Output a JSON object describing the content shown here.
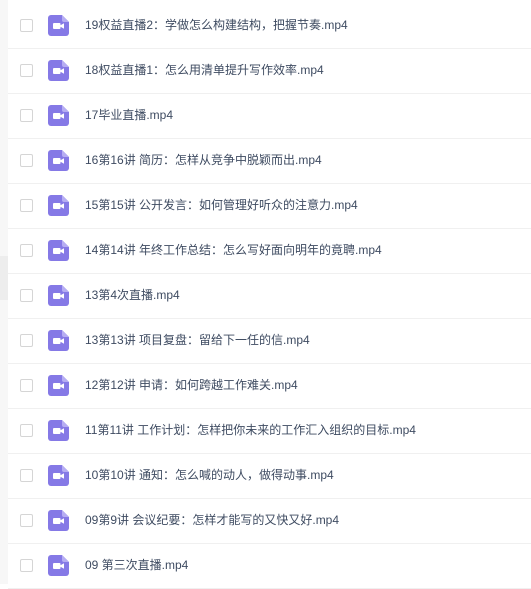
{
  "colors": {
    "video_icon": "#8579e6",
    "text": "#3e4b61",
    "divider": "#f0f0f0"
  },
  "file_icon": "video-file-icon",
  "files": [
    {
      "name": "19权益直播2：学做怎么构建结构，把握节奏.mp4"
    },
    {
      "name": "18权益直播1：怎么用清单提升写作效率.mp4"
    },
    {
      "name": "17毕业直播.mp4"
    },
    {
      "name": "16第16讲 简历：怎样从竞争中脱颖而出.mp4"
    },
    {
      "name": "15第15讲 公开发言：如何管理好听众的注意力.mp4"
    },
    {
      "name": "14第14讲 年终工作总结：怎么写好面向明年的竟聘.mp4"
    },
    {
      "name": "13第4次直播.mp4"
    },
    {
      "name": "13第13讲 项目复盘：留给下一任的信.mp4"
    },
    {
      "name": "12第12讲 申请：如何跨越工作难关.mp4"
    },
    {
      "name": "11第11讲 工作计划：怎样把你未来的工作汇入组织的目标.mp4"
    },
    {
      "name": "10第10讲 通知：怎么喊的动人，做得动事.mp4"
    },
    {
      "name": "09第9讲 会议纪要：怎样才能写的又快又好.mp4"
    },
    {
      "name": "09 第三次直播.mp4"
    }
  ]
}
